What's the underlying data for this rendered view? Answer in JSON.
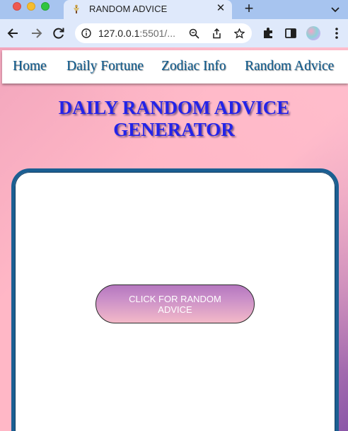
{
  "browser": {
    "tab": {
      "title": "RANDOM ADVICE",
      "close_glyph": "✕"
    },
    "new_tab_glyph": "+",
    "omnibox": {
      "url_main": "127.0.0.1",
      "url_rest": ":5501/..."
    },
    "icons": [
      "back-arrow-icon",
      "forward-arrow-icon",
      "reload-icon",
      "site-info-icon",
      "zoom-icon",
      "share-icon",
      "bookmark-star-icon",
      "extensions-puzzle-icon",
      "side-panel-icon",
      "profile-avatar-icon",
      "more-menu-icon",
      "tab-list-chevron-icon"
    ]
  },
  "nav": {
    "items": [
      {
        "label": "Home"
      },
      {
        "label": "Daily Fortune"
      },
      {
        "label": "Zodiac Info"
      },
      {
        "label": "Random Advice"
      }
    ]
  },
  "page": {
    "heading_line1": "DAILY RANDOM ADVICE",
    "heading_line2": "GENERATOR",
    "advice_button_label": "CLICK FOR RANDOM ADVICE"
  },
  "colors": {
    "nav_link": "#0d5a8d",
    "heading": "#2323e8",
    "card_border": "#1b5f92",
    "button_gradient_top": "#b577bf",
    "button_gradient_bottom": "#f3b9c8"
  }
}
